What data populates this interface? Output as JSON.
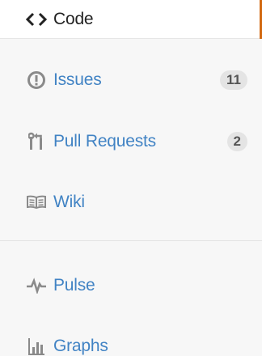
{
  "nav": {
    "code": {
      "label": "Code",
      "icon": "code-icon"
    },
    "issues": {
      "label": "Issues",
      "count": "11",
      "icon": "issue-opened-icon"
    },
    "pull_requests": {
      "label": "Pull Requests",
      "count": "2",
      "icon": "git-pull-request-icon"
    },
    "wiki": {
      "label": "Wiki",
      "icon": "book-icon"
    },
    "pulse": {
      "label": "Pulse",
      "icon": "pulse-icon"
    },
    "graphs": {
      "label": "Graphs",
      "icon": "graph-icon"
    }
  },
  "colors": {
    "accent_selected": "#d26911",
    "link": "#4183c4",
    "selected_text": "#222222",
    "background": "#f7f7f7"
  }
}
